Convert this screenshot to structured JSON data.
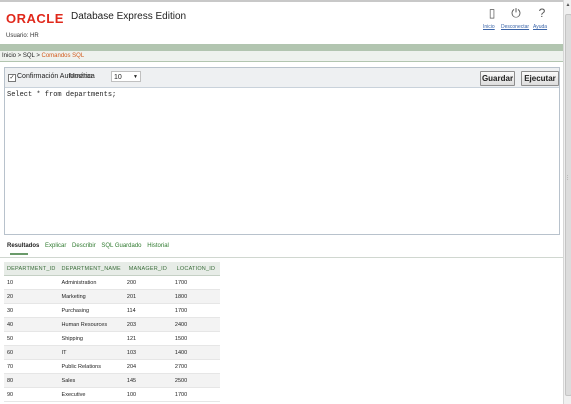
{
  "header": {
    "logo": "ORACLE",
    "product": "Database Express Edition",
    "user": "Usuario: HR",
    "links": {
      "home": "Inicio",
      "logout": "Desconectar",
      "help": "Ayuda"
    },
    "icons": [
      "home-icon",
      "power-icon",
      "help-icon"
    ]
  },
  "breadcrumb": {
    "home": "Inicio",
    "sep1": " > ",
    "sql": "SQL",
    "sep2": " > ",
    "current": "Comandos SQL"
  },
  "editor": {
    "autocommit_label": "Confirmación Automática",
    "show_label": "Mostrar",
    "show_value": "10",
    "save_button": "Guardar",
    "run_button": "Ejecutar",
    "sql_text": "Select * from departments;"
  },
  "results_tabs": [
    "Resultados",
    "Explicar",
    "Describir",
    "SQL Guardado",
    "Historial"
  ],
  "table": {
    "columns": [
      "DEPARTMENT_ID",
      "DEPARTMENT_NAME",
      "MANAGER_ID",
      "LOCATION_ID"
    ],
    "rows": [
      [
        "10",
        "Administration",
        "200",
        "1700"
      ],
      [
        "20",
        "Marketing",
        "201",
        "1800"
      ],
      [
        "30",
        "Purchasing",
        "114",
        "1700"
      ],
      [
        "40",
        "Human Resources",
        "203",
        "2400"
      ],
      [
        "50",
        "Shipping",
        "121",
        "1500"
      ],
      [
        "60",
        "IT",
        "103",
        "1400"
      ],
      [
        "70",
        "Public Relations",
        "204",
        "2700"
      ],
      [
        "80",
        "Sales",
        "145",
        "2500"
      ],
      [
        "90",
        "Executive",
        "100",
        "1700"
      ]
    ]
  },
  "colors": {
    "oracle_red": "#e0281b",
    "breadcrumb_current": "#d35a1b",
    "green_bar": "#b2c5b0"
  }
}
